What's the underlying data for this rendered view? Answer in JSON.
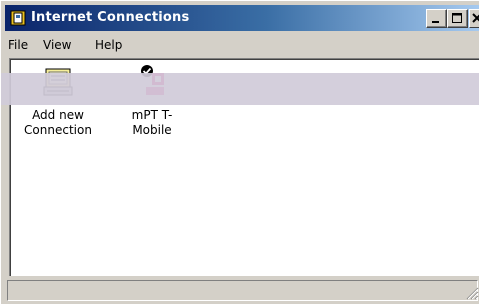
{
  "window": {
    "title": "Internet Connections"
  },
  "menu": {
    "file": "File",
    "view": "View",
    "help": "Help"
  },
  "items": [
    {
      "label": "Add new\nConnection",
      "icon": "add-connection-icon"
    },
    {
      "label": "mPT T-Mobile",
      "icon": "connection-checked-icon"
    }
  ],
  "colors": {
    "titlebar_start": "#0a246a",
    "titlebar_end": "#a6caf0",
    "window_face": "#d4d0c8",
    "content_bg": "#ffffff",
    "tmobile_magenta": "#e20074"
  }
}
